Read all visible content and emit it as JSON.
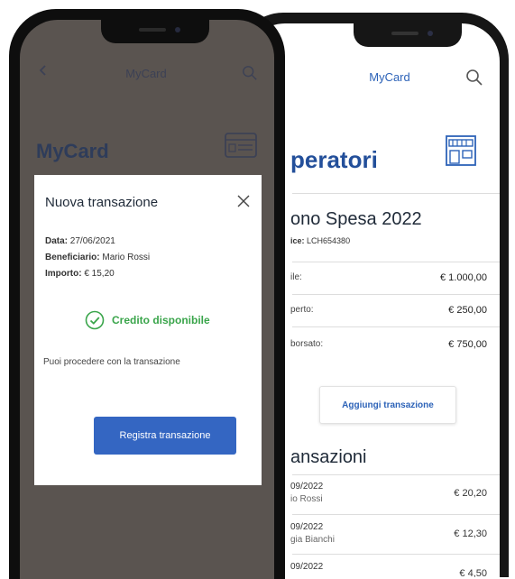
{
  "back_phone": {
    "app_title": "MyCard",
    "section_title": "peratori",
    "card": {
      "title": "ono Spesa 2022",
      "subtitle_label": "ice:",
      "subtitle_code": "LCH654380"
    },
    "rows": [
      {
        "label": "ile:",
        "value": "€ 1.000,00"
      },
      {
        "label": "perto:",
        "value": "€ 250,00"
      },
      {
        "label": "borsato:",
        "value": "€ 750,00"
      }
    ],
    "add_button": "Aggiungi transazione",
    "transactions_title": "ansazioni",
    "transactions": [
      {
        "date": "09/2022",
        "name": "io Rossi",
        "amount": "€ 20,20"
      },
      {
        "date": "09/2022",
        "name": "gia Bianchi",
        "amount": "€ 12,30"
      },
      {
        "date": "09/2022",
        "name": "",
        "amount": "€ 4,50"
      }
    ]
  },
  "front_phone": {
    "app_title": "MyCard",
    "section_title": "MyCard",
    "modal": {
      "title": "Nuova transazione",
      "fields": [
        {
          "label": "Data:",
          "value": "27/06/2021"
        },
        {
          "label": "Beneficiario:",
          "value": "Mario Rossi"
        },
        {
          "label": "Importo:",
          "value": "€ 15,20"
        }
      ],
      "status": "Credito disponibile",
      "message": "Puoi procedere con la transazione",
      "button": "Registra transazione"
    }
  },
  "colors": {
    "accent": "#3466c2",
    "heading_blue": "#234f9a",
    "success": "#3aa54b",
    "overlay": "#5a5450"
  }
}
